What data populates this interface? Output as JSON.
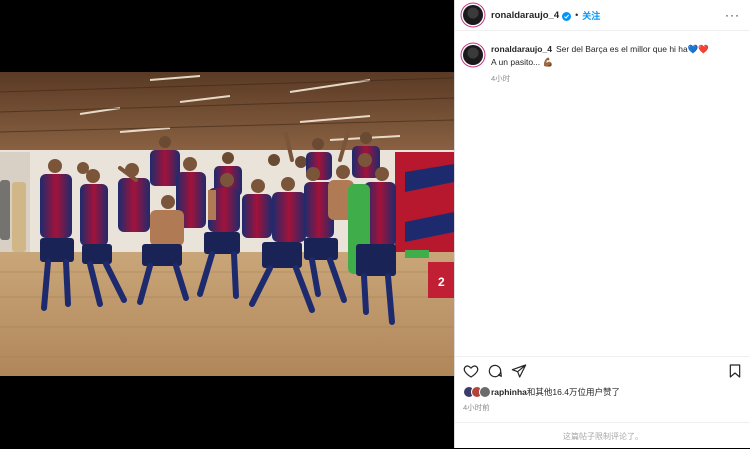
{
  "post": {
    "username": "ronaldaraujo_4",
    "follow_label": "关注",
    "more_label": "···",
    "caption_username": "ronaldaraujo_4",
    "caption_text": "Ser del Barça es el millor que hi ha",
    "caption_emoji_hearts": [
      "💙",
      "❤️"
    ],
    "caption_line2": "A un pasito...",
    "caption_emoji_arm": "💪🏾",
    "caption_time": "4小时",
    "likes_user": "raphinha",
    "likes_text": "和其他16.4万位用户赞了",
    "post_time": "4小时前",
    "comments_placeholder": "这篇帖子限制评论了。"
  },
  "icons": {
    "verified": "verified-badge-icon",
    "more": "more-options-icon",
    "like": "heart-icon",
    "comment": "comment-icon",
    "share": "share-icon",
    "save": "bookmark-icon"
  },
  "colors": {
    "accent": "#0095f6",
    "text": "#262626",
    "muted": "#8e8e8e",
    "background": "#ffffff",
    "media_background": "#000000"
  }
}
